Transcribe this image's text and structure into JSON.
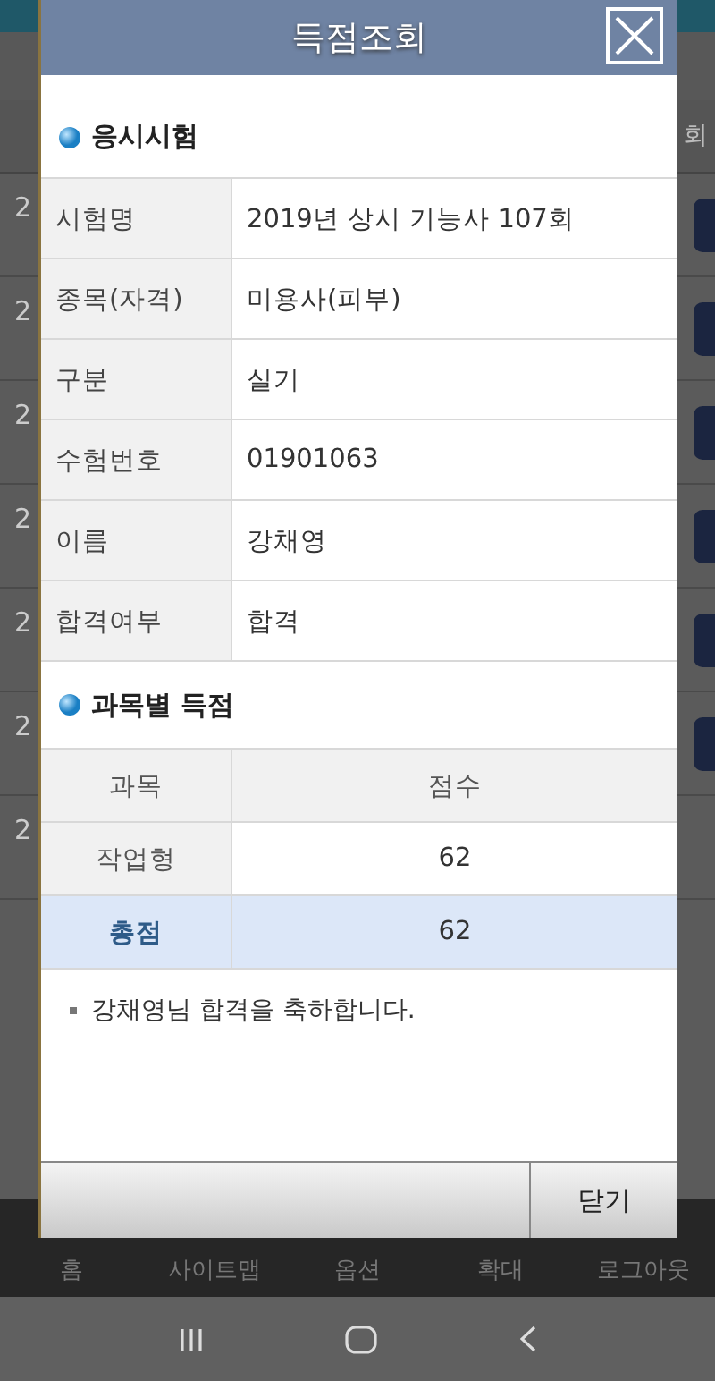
{
  "background": {
    "header_fragment": "회",
    "rows": [
      {
        "number": "2",
        "has_button": true
      },
      {
        "number": "2",
        "has_button": true
      },
      {
        "number": "2",
        "has_button": true
      },
      {
        "number": "2",
        "has_button": true
      },
      {
        "number": "2",
        "has_button": true
      },
      {
        "number": "2",
        "has_button": true
      },
      {
        "number": "2",
        "has_button": false
      }
    ],
    "nav": [
      "홈",
      "사이트맵",
      "옵션",
      "확대",
      "로그아웃"
    ]
  },
  "dialog": {
    "title": "득점조회",
    "exam_heading": "응시시험",
    "exam_info": [
      {
        "label": "시험명",
        "value": "2019년 상시 기능사 107회"
      },
      {
        "label": "종목(자격)",
        "value": "미용사(피부)"
      },
      {
        "label": "구분",
        "value": "실기"
      },
      {
        "label": "수험번호",
        "value": "01901063"
      },
      {
        "label": "이름",
        "value": "강채영"
      },
      {
        "label": "합격여부",
        "value": "합격"
      }
    ],
    "score_heading": "과목별 득점",
    "score_columns": [
      "과목",
      "점수"
    ],
    "score_rows": [
      {
        "kind": "subject",
        "subject": "작업형",
        "score": "62"
      },
      {
        "kind": "total",
        "subject": "총점",
        "score": "62"
      }
    ],
    "message": "강채영님 합격을 축하합니다.",
    "footer_button": "닫기"
  }
}
